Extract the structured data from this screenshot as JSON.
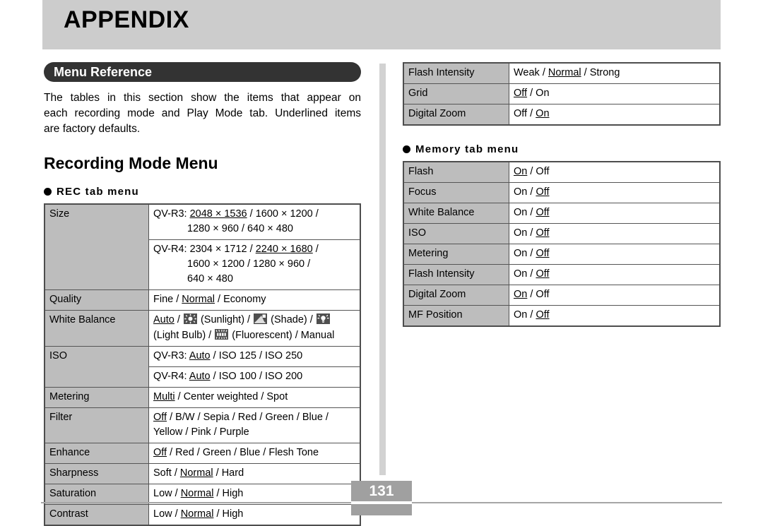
{
  "header": {
    "title": "APPENDIX"
  },
  "section": {
    "banner_label": "Menu Reference",
    "intro_line1": "The tables in this section show the items that appear on",
    "intro_line2": "each recording mode and Play Mode tab. Underlined items",
    "intro_line3": "are factory defaults.",
    "heading": "Recording Mode Menu"
  },
  "left_column": {
    "rec_tab_heading": "REC tab menu",
    "rows": [
      {
        "label": "Size",
        "lines": [
          {
            "text": "QV-R3: ",
            "underlined": "2048 × 1536",
            "rest": " / 1600 × 1200 /",
            "indent": false
          },
          {
            "text": "1280 × 960 / 640 × 480",
            "indent": true
          }
        ]
      },
      {
        "label": "",
        "lines": [
          {
            "text": "QV-R4: 2304 × 1712 / ",
            "underlined": "2240 × 1680",
            "rest": " /",
            "indent": false
          },
          {
            "text": "1600 × 1200 / 1280 × 960 /",
            "indent": true
          },
          {
            "text": "640 × 480",
            "indent": true
          }
        ]
      },
      {
        "label": "Quality",
        "lines": [
          {
            "text": "Fine / ",
            "underlined": "Normal",
            "rest": " / Economy",
            "indent": false
          }
        ]
      },
      {
        "label": "White Balance",
        "icon_row": true,
        "line1_pre": "",
        "underlined": "Auto",
        "sunlight_label": "(Sunlight)",
        "shade_label": "(Shade)",
        "lightbulb_label": "(Light Bulb)",
        "fluorescent_label": "(Fluorescent)",
        "manual_label": "Manual"
      },
      {
        "label": "ISO",
        "lines": [
          {
            "text": "QV-R3: ",
            "underlined": "Auto",
            "rest": " / ISO 125 / ISO 250",
            "indent": false
          }
        ]
      },
      {
        "label": "",
        "lines": [
          {
            "text": "QV-R4: ",
            "underlined": "Auto",
            "rest": " / ISO 100 / ISO 200",
            "indent": false
          }
        ]
      },
      {
        "label": "Metering",
        "lines": [
          {
            "text": "",
            "underlined": "Multi",
            "rest": " / Center weighted / Spot",
            "indent": false
          }
        ]
      },
      {
        "label": "Filter",
        "lines": [
          {
            "text": "",
            "underlined": "Off",
            "rest": " / B/W / Sepia / Red / Green / Blue /",
            "indent": false
          },
          {
            "text": "Yellow / Pink / Purple",
            "indent": false
          }
        ]
      },
      {
        "label": "Enhance",
        "lines": [
          {
            "text": "",
            "underlined": "Off",
            "rest": " / Red / Green / Blue / Flesh Tone",
            "indent": false
          }
        ]
      },
      {
        "label": "Sharpness",
        "lines": [
          {
            "text": "Soft / ",
            "underlined": "Normal",
            "rest": " / Hard",
            "indent": false
          }
        ]
      },
      {
        "label": "Saturation",
        "lines": [
          {
            "text": "Low / ",
            "underlined": "Normal",
            "rest": " / High",
            "indent": false
          }
        ]
      },
      {
        "label": "Contrast",
        "lines": [
          {
            "text": "Low / ",
            "underlined": "Normal",
            "rest": " / High",
            "indent": false
          }
        ]
      }
    ]
  },
  "right_column": {
    "top_table_rows": [
      {
        "label": "Flash Intensity",
        "pre": "Weak / ",
        "underlined": "Normal",
        "post": " / Strong"
      },
      {
        "label": "Grid",
        "pre": "",
        "underlined": "Off",
        "post": " / On"
      },
      {
        "label": "Digital Zoom",
        "pre": "Off / ",
        "underlined": "On",
        "post": ""
      }
    ],
    "memory_tab_heading": "Memory tab menu",
    "memory_rows": [
      {
        "label": "Flash",
        "pre": "",
        "underlined": "On",
        "post": " / Off"
      },
      {
        "label": "Focus",
        "pre": "On / ",
        "underlined": "Off",
        "post": ""
      },
      {
        "label": "White Balance",
        "pre": "On / ",
        "underlined": "Off",
        "post": ""
      },
      {
        "label": "ISO",
        "pre": "On / ",
        "underlined": "Off",
        "post": ""
      },
      {
        "label": "Metering",
        "pre": "On / ",
        "underlined": "Off",
        "post": ""
      },
      {
        "label": "Flash Intensity",
        "pre": "On / ",
        "underlined": "Off",
        "post": ""
      },
      {
        "label": "Digital Zoom",
        "pre": "",
        "underlined": "On",
        "post": " / Off"
      },
      {
        "label": "MF Position",
        "pre": "On / ",
        "underlined": "Off",
        "post": ""
      }
    ]
  },
  "footer": {
    "page_number": "131"
  },
  "colors": {
    "header_bg": "#cccccc",
    "banner_bg": "#333333",
    "table_label_bg": "#bdbdbd",
    "divider": "#d2d2d2",
    "page_box": "#a0a0a0",
    "icon_bg": "#4f4f4f"
  }
}
